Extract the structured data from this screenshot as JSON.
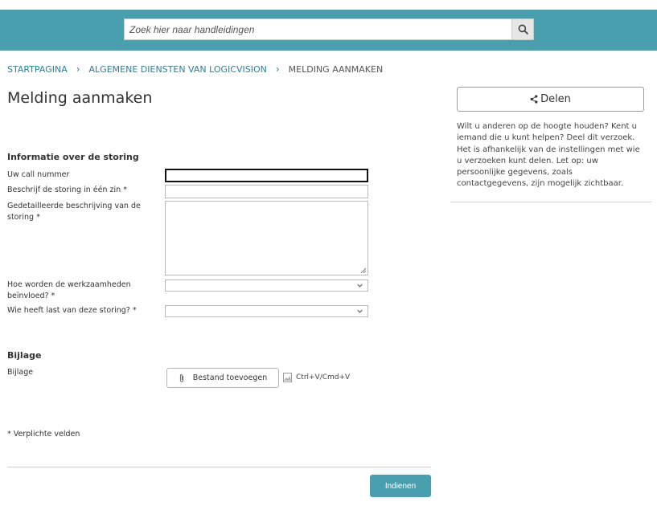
{
  "header": {
    "search": {
      "placeholder": "Zoek hier naar handleidingen",
      "icon": "search-icon"
    },
    "bar_color": "#4a9fae"
  },
  "breadcrumb": {
    "items": [
      "STARTPAGINA",
      "ALGEMENE DIENSTEN VAN LOGICVISION"
    ],
    "current": "MELDING AANMAKEN",
    "separator": "›"
  },
  "page": {
    "title": "Melding aanmaken"
  },
  "form": {
    "section_info": "Informatie over de storing",
    "fields": {
      "call_number": {
        "label": "Uw call nummer",
        "value": ""
      },
      "summary": {
        "label": "Beschrijf de storing in één zin *",
        "value": ""
      },
      "description": {
        "label": "Gedetailleerde beschrijving van de storing *",
        "value": ""
      },
      "impact": {
        "label": "Hoe worden de werkzaamheden beïnvloed? *",
        "value": ""
      },
      "affected": {
        "label": "Wie heeft last van deze storing? *",
        "value": ""
      }
    },
    "section_attachment": "Bijlage",
    "attachment": {
      "label": "Bijlage",
      "button": "Bestand toevoegen",
      "paste_hint": "Ctrl+V/Cmd+V"
    },
    "required_note": "* Verplichte velden",
    "submit": "Indienen"
  },
  "sidebar": {
    "share_button": "Delen",
    "share_text": "Wilt u anderen op de hoogte houden? Kent u iemand die u kunt helpen? Deel dit verzoek. Het is afhankelijk van de instellingen met wie u verzoeken kunt delen. Let op: uw persoonlijke gegevens, zoals contactgegevens, zijn mogelijk zichtbaar."
  },
  "colors": {
    "accent": "#4a9fae",
    "link": "#2e7f94"
  }
}
